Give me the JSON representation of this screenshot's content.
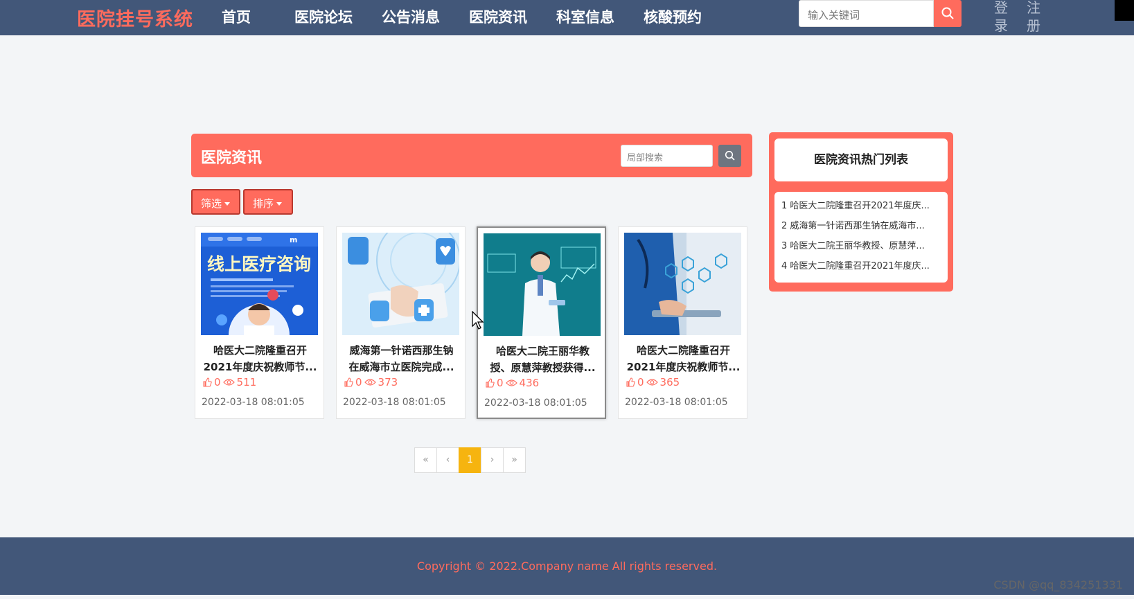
{
  "brand": {
    "title": "医院挂号系统",
    "accent": "#ff6b5d",
    "nav_bg": "#425779"
  },
  "nav": {
    "items": [
      "首页",
      "医院论坛",
      "公告消息",
      "医院资讯",
      "科室信息",
      "核酸预约"
    ],
    "search_placeholder": "输入关键词",
    "login_chars": [
      "登",
      "录"
    ],
    "register_chars": [
      "注",
      "册"
    ]
  },
  "section": {
    "title": "医院资讯",
    "local_search_placeholder": "局部搜索",
    "filter_label": "筛选",
    "sort_label": "排序"
  },
  "cards": [
    {
      "title_line1": "哈医大二院隆重召开",
      "title_line2": "2021年度庆祝教师节...",
      "likes": "0",
      "views": "511",
      "date": "2022-03-18 08:01:05",
      "image_text": "线上医疗咨询"
    },
    {
      "title_line1": "威海第一针诺西那生钠",
      "title_line2": "在威海市立医院完成...",
      "likes": "0",
      "views": "373",
      "date": "2022-03-18 08:01:05"
    },
    {
      "title_line1": "哈医大二院王丽华教",
      "title_line2": "授、原慧萍教授获得...",
      "likes": "0",
      "views": "436",
      "date": "2022-03-18 08:01:05"
    },
    {
      "title_line1": "哈医大二院隆重召开",
      "title_line2": "2021年度庆祝教师节...",
      "likes": "0",
      "views": "365",
      "date": "2022-03-18 08:01:05"
    }
  ],
  "pagination": {
    "first": "«",
    "prev": "‹",
    "current": "1",
    "next": "›",
    "last": "»"
  },
  "hot": {
    "title": "医院资讯热门列表",
    "items": [
      "1 哈医大二院隆重召开2021年度庆...",
      "2 威海第一针诺西那生钠在威海市...",
      "3 哈医大二院王丽华教授、原慧萍...",
      "4 哈医大二院隆重召开2021年度庆..."
    ]
  },
  "footer": {
    "copyright": "Copyright © 2022.Company name All rights reserved."
  },
  "watermark": "CSDN @qq_834251331"
}
